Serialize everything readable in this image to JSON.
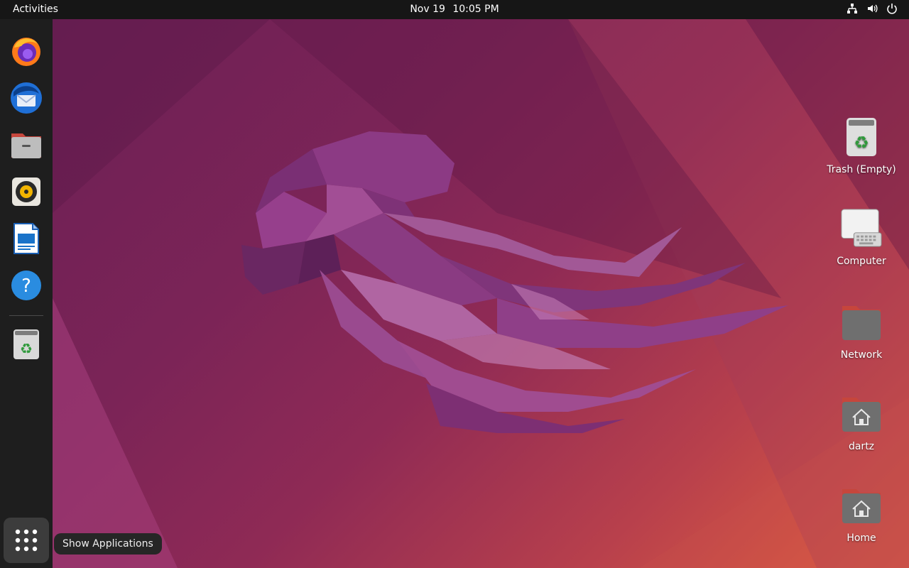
{
  "topbar": {
    "activities": "Activities",
    "date": "Nov 19",
    "time": "10:05 PM",
    "tray_icons": [
      "network-icon",
      "volume-icon",
      "power-icon"
    ]
  },
  "dock": {
    "items": [
      {
        "name": "firefox",
        "icon": "firefox-icon"
      },
      {
        "name": "thunderbird",
        "icon": "thunderbird-icon"
      },
      {
        "name": "files",
        "icon": "files-icon"
      },
      {
        "name": "rhythmbox",
        "icon": "rhythmbox-icon"
      },
      {
        "name": "libreoffice-writer",
        "icon": "writer-icon"
      },
      {
        "name": "help",
        "icon": "help-icon"
      },
      {
        "name": "trash",
        "icon": "trash-icon"
      }
    ],
    "show_apps_tooltip": "Show Applications"
  },
  "desktop": {
    "icons": [
      {
        "label": "Trash (Empty)",
        "icon": "trash-icon"
      },
      {
        "label": "Computer",
        "icon": "computer-icon"
      },
      {
        "label": "Network",
        "icon": "network-folder-icon"
      },
      {
        "label": "dartz",
        "icon": "home-folder-icon"
      },
      {
        "label": "Home",
        "icon": "home-folder-icon"
      }
    ]
  },
  "colors": {
    "topbar": "#161616",
    "dock": "#1e1e1e",
    "wallpaper_primary": "#7b2457",
    "wallpaper_accent": "#e2603f"
  }
}
